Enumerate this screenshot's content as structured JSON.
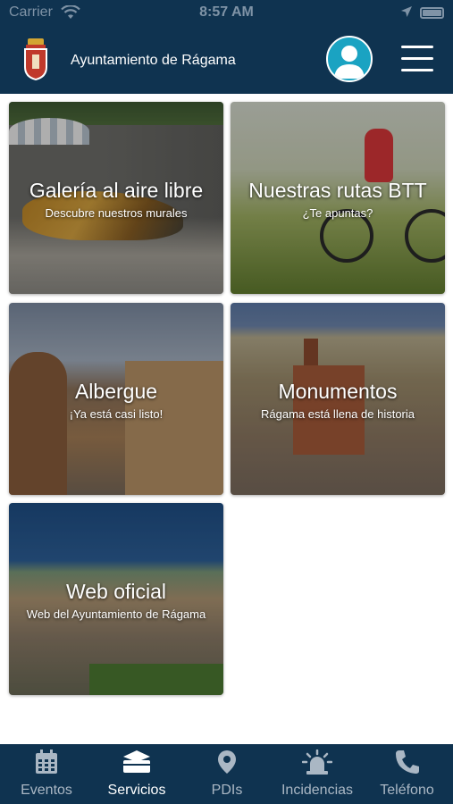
{
  "status_bar": {
    "carrier": "Carrier",
    "time": "8:57 AM"
  },
  "header": {
    "title": "Ayuntamiento de Rágama"
  },
  "cards": [
    {
      "title": "Galería al aire libre",
      "subtitle": "Descubre nuestros murales"
    },
    {
      "title": "Nuestras rutas BTT",
      "subtitle": "¿Te apuntas?"
    },
    {
      "title": "Albergue",
      "subtitle": "¡Ya está casi listo!"
    },
    {
      "title": "Monumentos",
      "subtitle": "Rágama está llena de historia"
    },
    {
      "title": "Web oficial",
      "subtitle": "Web del Ayuntamiento de Rágama"
    }
  ],
  "tabbar": {
    "active": "Servicios",
    "tabs": [
      {
        "label": "Eventos",
        "icon": "calendar-icon"
      },
      {
        "label": "Servicios",
        "icon": "services-icon"
      },
      {
        "label": "PDIs",
        "icon": "map-pin-icon"
      },
      {
        "label": "Incidencias",
        "icon": "alarm-light-icon"
      },
      {
        "label": "Teléfono",
        "icon": "phone-icon"
      }
    ]
  },
  "colors": {
    "navy": "#0f3350",
    "avatar_bg": "#1aa3c2",
    "tab_inactive": "#aab7c4",
    "tab_active": "#ffffff"
  }
}
